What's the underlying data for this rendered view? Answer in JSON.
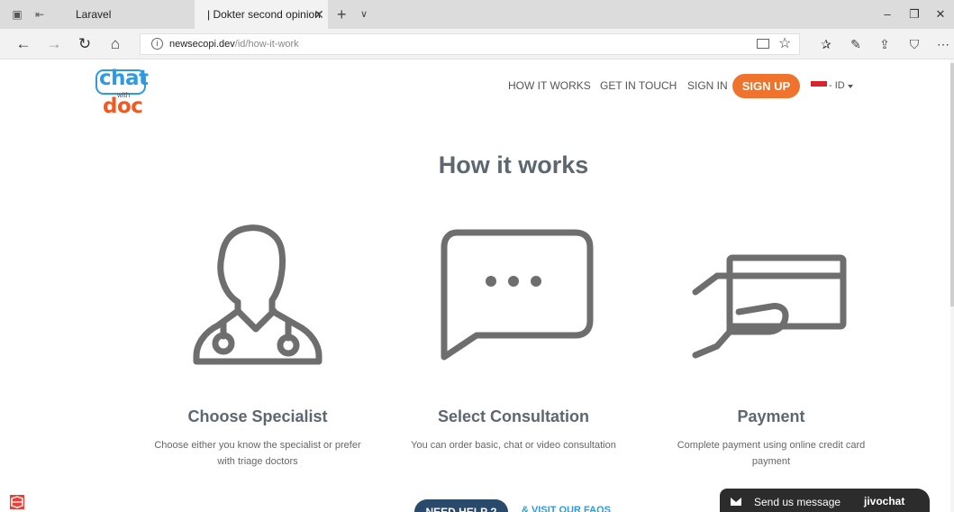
{
  "browser": {
    "tabs": [
      {
        "label": "Laravel"
      },
      {
        "label": "| Dokter second opinion"
      }
    ],
    "url_domain": "newsecopi.dev",
    "url_path": "/id/how-it-work"
  },
  "nav": {
    "links": [
      "HOW IT WORKS",
      "GET IN TOUCH",
      "SIGN IN"
    ],
    "signup": "SIGN UP",
    "lang": "- ID"
  },
  "logo": {
    "top": "chat",
    "middle": "with",
    "bottom": "doc"
  },
  "page": {
    "title": "How it works"
  },
  "features": [
    {
      "icon": "doctor-icon",
      "title": "Choose Specialist",
      "desc_line1": "Choose either you know the specialist or prefer",
      "desc_line2": "with triage doctors"
    },
    {
      "icon": "chat-bubble-icon",
      "title": "Select Consultation",
      "desc_line1": "You can order basic, chat or video consultation",
      "desc_line2": ""
    },
    {
      "icon": "credit-card-hand-icon",
      "title": "Payment",
      "desc_line1": "Complete payment using online credit card",
      "desc_line2": "payment"
    }
  ],
  "help": {
    "need_help": "NEED HELP ?",
    "visit_faqs": "& VISIT OUR FAQS"
  },
  "livechat": {
    "message": "Send us message",
    "brand": "jivochat"
  },
  "colors": {
    "accent_orange": "#f0732d",
    "logo_blue": "#2e9be0",
    "logo_orange": "#f05a22",
    "dark_blue": "#2a4a6b",
    "heading_gray": "#5c6770"
  }
}
